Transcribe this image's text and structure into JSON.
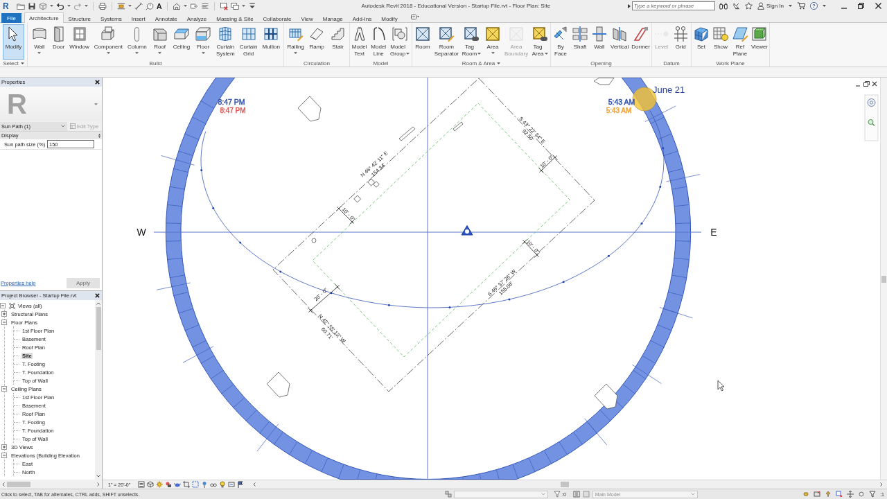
{
  "app_button": {
    "label": "R"
  },
  "quick_access": {
    "text_tool": "A"
  },
  "window": {
    "title": "Autodesk Revit 2018 - Educational Version - Startup File.rvt - Floor Plan: Site"
  },
  "search": {
    "placeholder": "Type a keyword or phrase"
  },
  "account": {
    "label": "Sign In"
  },
  "help": {
    "label": "?"
  },
  "tabs": [
    {
      "label": "File",
      "kind": "file",
      "selected": false
    },
    {
      "label": "Architecture",
      "kind": "tab",
      "selected": true
    },
    {
      "label": "Structure",
      "kind": "tab",
      "selected": false
    },
    {
      "label": "Systems",
      "kind": "tab",
      "selected": false
    },
    {
      "label": "Insert",
      "kind": "tab",
      "selected": false
    },
    {
      "label": "Annotate",
      "kind": "tab",
      "selected": false
    },
    {
      "label": "Analyze",
      "kind": "tab",
      "selected": false
    },
    {
      "label": "Massing & Site",
      "kind": "tab",
      "selected": false
    },
    {
      "label": "Collaborate",
      "kind": "tab",
      "selected": false
    },
    {
      "label": "View",
      "kind": "tab",
      "selected": false
    },
    {
      "label": "Manage",
      "kind": "tab",
      "selected": false
    },
    {
      "label": "Add-Ins",
      "kind": "tab",
      "selected": false
    },
    {
      "label": "Modify",
      "kind": "tab",
      "selected": false
    }
  ],
  "ribbon": {
    "panels": [
      {
        "title": "Select",
        "dropdown": true,
        "tools": [
          {
            "label": "Modify",
            "kind": "button",
            "selected": true,
            "disabled": false
          }
        ]
      },
      {
        "title": "Build",
        "dropdown": false,
        "tools": [
          {
            "label": "Wall",
            "kind": "dropdown",
            "selected": false,
            "disabled": false
          },
          {
            "label": "Door",
            "kind": "button",
            "selected": false,
            "disabled": false
          },
          {
            "label": "Window",
            "kind": "button",
            "selected": false,
            "disabled": false
          },
          {
            "label": "Component",
            "kind": "dropdown",
            "selected": false,
            "disabled": false
          },
          {
            "label": "Column",
            "kind": "dropdown",
            "selected": false,
            "disabled": false
          },
          {
            "label": "Roof",
            "kind": "dropdown",
            "selected": false,
            "disabled": false
          },
          {
            "label": "Ceiling",
            "kind": "button",
            "selected": false,
            "disabled": false
          },
          {
            "label": "Floor",
            "kind": "dropdown",
            "selected": false,
            "disabled": false
          },
          {
            "label": "Curtain System",
            "kind": "button",
            "selected": false,
            "disabled": false
          },
          {
            "label": "Curtain Grid",
            "kind": "button",
            "selected": false,
            "disabled": false
          },
          {
            "label": "Mullion",
            "kind": "button",
            "selected": false,
            "disabled": false
          }
        ]
      },
      {
        "title": "Circulation",
        "dropdown": false,
        "tools": [
          {
            "label": "Railing",
            "kind": "dropdown",
            "selected": false,
            "disabled": false
          },
          {
            "label": "Ramp",
            "kind": "button",
            "selected": false,
            "disabled": false
          },
          {
            "label": "Stair",
            "kind": "button",
            "selected": false,
            "disabled": false
          }
        ]
      },
      {
        "title": "Model",
        "dropdown": false,
        "tools": [
          {
            "label": "Model Text",
            "kind": "button",
            "selected": false,
            "disabled": false
          },
          {
            "label": "Model Line",
            "kind": "button",
            "selected": false,
            "disabled": false
          },
          {
            "label": "Model Group",
            "kind": "split",
            "selected": false,
            "disabled": false
          }
        ]
      },
      {
        "title": "Room & Area",
        "dropdown": true,
        "tools": [
          {
            "label": "Room",
            "kind": "button",
            "selected": false,
            "disabled": false
          },
          {
            "label": "Room Separator",
            "kind": "button",
            "selected": false,
            "disabled": false
          },
          {
            "label": "Tag Room",
            "kind": "split",
            "selected": false,
            "disabled": false
          },
          {
            "label": "Area",
            "kind": "dropdown",
            "selected": false,
            "disabled": false
          },
          {
            "label": "Area Boundary",
            "kind": "button",
            "selected": false,
            "disabled": true
          },
          {
            "label": "Tag Area",
            "kind": "split",
            "selected": false,
            "disabled": false
          }
        ]
      },
      {
        "title": "Opening",
        "dropdown": false,
        "tools": [
          {
            "label": "By Face",
            "kind": "button",
            "selected": false,
            "disabled": false
          },
          {
            "label": "Shaft",
            "kind": "button",
            "selected": false,
            "disabled": false
          },
          {
            "label": "Wall",
            "kind": "button",
            "selected": false,
            "disabled": false
          },
          {
            "label": "Vertical",
            "kind": "button",
            "selected": false,
            "disabled": false
          },
          {
            "label": "Dormer",
            "kind": "button",
            "selected": false,
            "disabled": false
          }
        ]
      },
      {
        "title": "Datum",
        "dropdown": false,
        "tools": [
          {
            "label": "Level",
            "kind": "button",
            "selected": false,
            "disabled": true
          },
          {
            "label": "Grid",
            "kind": "button",
            "selected": false,
            "disabled": false
          }
        ]
      },
      {
        "title": "Work Plane",
        "dropdown": false,
        "tools": [
          {
            "label": "Set",
            "kind": "button",
            "selected": false,
            "disabled": false
          },
          {
            "label": "Show",
            "kind": "button",
            "selected": false,
            "disabled": false
          },
          {
            "label": "Ref Plane",
            "kind": "button",
            "selected": false,
            "disabled": false
          },
          {
            "label": "Viewer",
            "kind": "button",
            "selected": false,
            "disabled": false
          }
        ]
      }
    ]
  },
  "properties": {
    "title": "Properties",
    "type_preview": "R",
    "type_selector": "Sun Path (1)",
    "edit_type": {
      "label": "Edit Type",
      "disabled": true
    },
    "groups": [
      {
        "title": "Display",
        "rows": [
          {
            "label": "Sun path size (%)",
            "value": "150"
          }
        ]
      }
    ],
    "help_link": "Properties help",
    "apply": {
      "label": "Apply",
      "disabled": true
    }
  },
  "project_browser": {
    "title": "Project Browser - Startup File.rvt",
    "tree": [
      {
        "label": "Views (all)",
        "expanded": true,
        "selected": false,
        "children": [
          {
            "label": "Structural Plans",
            "expanded": false,
            "selected": false
          },
          {
            "label": "Floor Plans",
            "expanded": true,
            "selected": false,
            "children": [
              {
                "label": "1st Floor Plan",
                "selected": false
              },
              {
                "label": "Basement",
                "selected": false
              },
              {
                "label": "Roof Plan",
                "selected": false
              },
              {
                "label": "Site",
                "selected": true
              },
              {
                "label": "T. Footing",
                "selected": false
              },
              {
                "label": "T. Foundation",
                "selected": false
              },
              {
                "label": "Top of Wall",
                "selected": false
              }
            ]
          },
          {
            "label": "Ceiling Plans",
            "expanded": true,
            "selected": false,
            "children": [
              {
                "label": "1st Floor Plan",
                "selected": false
              },
              {
                "label": "Basement",
                "selected": false
              },
              {
                "label": "Roof Plan",
                "selected": false
              },
              {
                "label": "T. Footing",
                "selected": false
              },
              {
                "label": "T. Foundation",
                "selected": false
              },
              {
                "label": "Top of Wall",
                "selected": false
              }
            ]
          },
          {
            "label": "3D Views",
            "expanded": false,
            "selected": false
          },
          {
            "label": "Elevations (Building Elevation",
            "expanded": true,
            "selected": false,
            "children": [
              {
                "label": "East",
                "selected": false
              },
              {
                "label": "North",
                "selected": false
              }
            ]
          }
        ]
      }
    ]
  },
  "site_view": {
    "compass": [
      {
        "kind": "west",
        "text": "W"
      },
      {
        "kind": "east",
        "text": "E"
      }
    ],
    "sun_path": {
      "date": "June 21",
      "sunset_times": [
        {
          "text": "8:47 PM",
          "color": "#2d4fae"
        },
        {
          "text": "8:47 PM",
          "color": "#e5534f"
        }
      ],
      "sunrise_times": [
        {
          "text": "5:43 AM",
          "color": "#2d4fae"
        },
        {
          "text": "5:43 AM",
          "color": "#f0a030"
        }
      ]
    },
    "annotations": [
      {
        "text": "S 43° 22' 34\" E"
      },
      {
        "text": "92.50'"
      },
      {
        "text": "10' - 0\""
      },
      {
        "text": "N 46° 42' 11\" E"
      },
      {
        "text": "154.34'"
      },
      {
        "text": "10' - 0\""
      },
      {
        "text": "10' - 0\""
      },
      {
        "text": "S 46° 37' 26\" W"
      },
      {
        "text": "155.08'"
      },
      {
        "text": "20' - 0\""
      },
      {
        "text": "N 42° 55' 13\" W"
      },
      {
        "text": "60.71'"
      }
    ]
  },
  "view_controls": {
    "scale": "1\" = 20'-0\""
  },
  "status_bar": {
    "message": "Click to select, TAB for alternates, CTRL adds, SHIFT unselects.",
    "editable_count": ":0",
    "model": "Main Model",
    "filter_count": ":1"
  }
}
